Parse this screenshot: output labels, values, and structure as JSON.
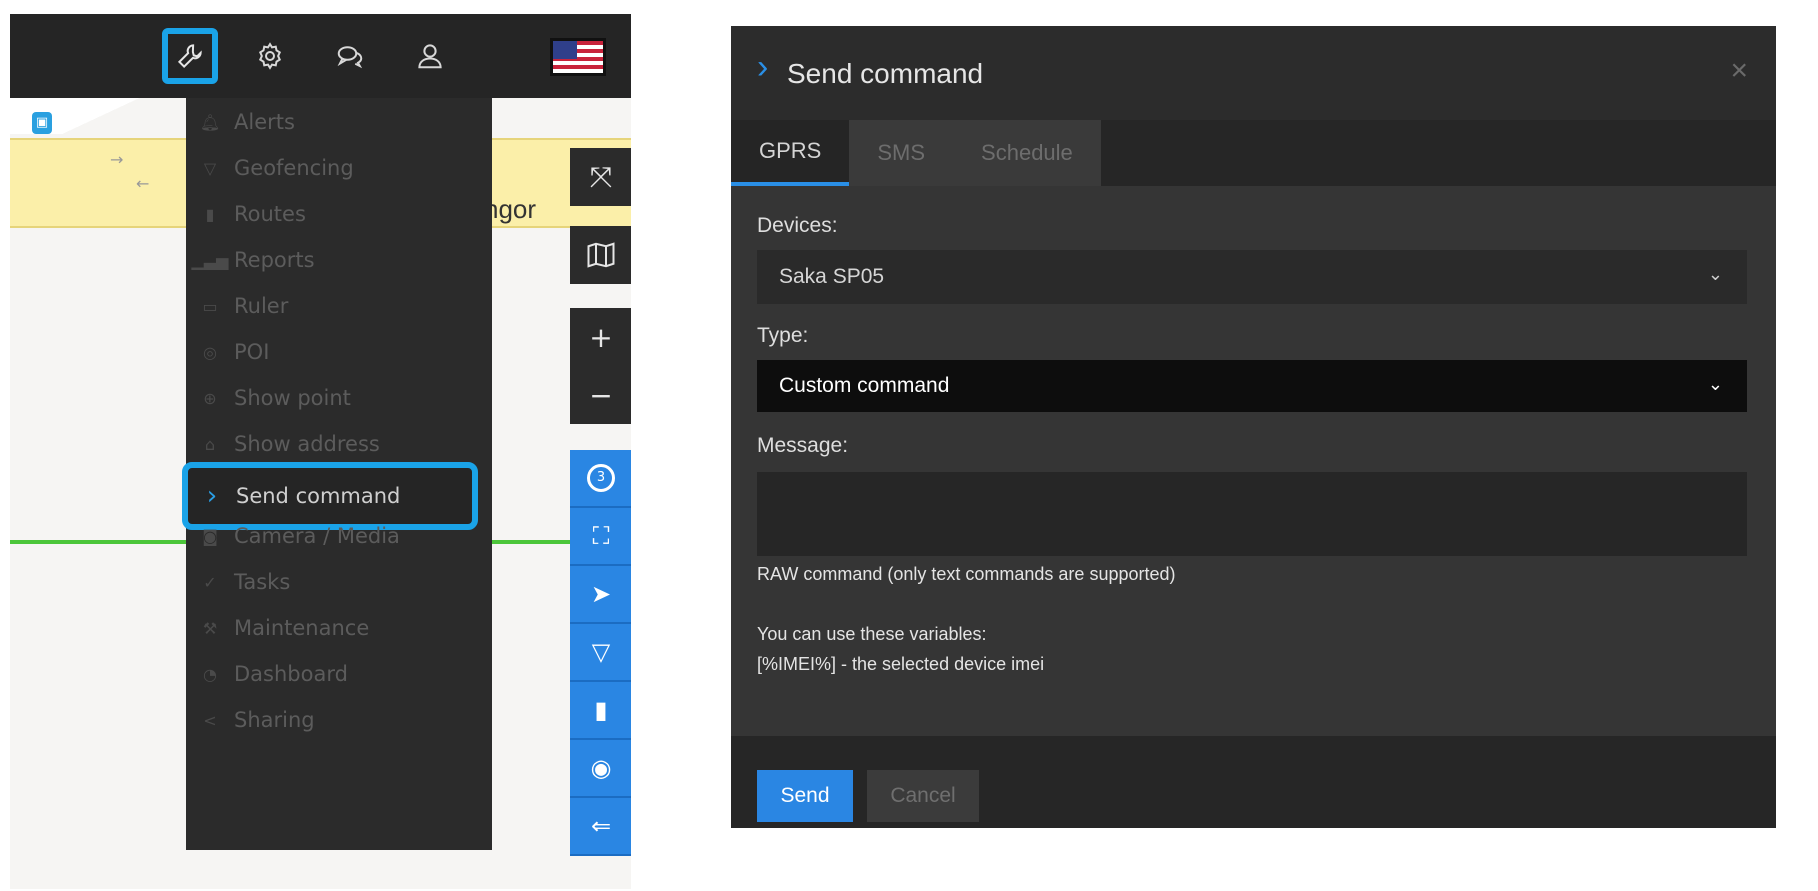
{
  "colors": {
    "accent": "#1aa3e8",
    "primary_button": "#2a86e3",
    "panel_dark": "#262626",
    "menu_bg": "#2b2b2b"
  },
  "toolbar": {
    "icons": [
      "wrench-icon",
      "gear-icon",
      "chat-icon",
      "user-icon",
      "us-flag-icon"
    ],
    "active": "wrench-icon"
  },
  "map": {
    "road_label": "ngor"
  },
  "tools_menu": {
    "items": [
      {
        "label": "Alerts",
        "icon": "bell-icon"
      },
      {
        "label": "Geofencing",
        "icon": "geofence-icon"
      },
      {
        "label": "Routes",
        "icon": "route-icon"
      },
      {
        "label": "Reports",
        "icon": "bar-chart-icon"
      },
      {
        "label": "Ruler",
        "icon": "ruler-icon"
      },
      {
        "label": "POI",
        "icon": "poi-pin-icon"
      },
      {
        "label": "Show point",
        "icon": "crosshair-icon"
      },
      {
        "label": "Show address",
        "icon": "home-icon"
      },
      {
        "label": "Send command",
        "icon": "chevron-right-icon"
      },
      {
        "label": "Camera / Media",
        "icon": "camera-icon"
      },
      {
        "label": "Tasks",
        "icon": "check-icon"
      },
      {
        "label": "Maintenance",
        "icon": "wrench-small-icon"
      },
      {
        "label": "Dashboard",
        "icon": "dashboard-icon"
      },
      {
        "label": "Sharing",
        "icon": "share-icon"
      }
    ],
    "selected": "Send command"
  },
  "map_controls": {
    "dark": [
      "fullscreen-icon",
      "map-layers-icon",
      "zoom-in-icon",
      "zoom-out-icon"
    ],
    "blue": [
      "clusters-icon",
      "fit-bounds-icon",
      "navigate-icon",
      "geofence-toggle-icon",
      "road-icon",
      "pin-icon",
      "history-icon"
    ],
    "clusters_count": "3"
  },
  "dialog": {
    "title": "Send command",
    "tabs": [
      "GPRS",
      "SMS",
      "Schedule"
    ],
    "active_tab": "GPRS",
    "devices_label": "Devices:",
    "devices_value": "Saka SP05",
    "type_label": "Type:",
    "type_value": "Custom command",
    "message_label": "Message:",
    "message_value": "",
    "raw_note": "RAW command (only text commands are supported)",
    "variables_note": "You can use these variables:",
    "variables_line": "[%IMEI%] - the selected device imei",
    "send_label": "Send",
    "cancel_label": "Cancel",
    "close_glyph": "×"
  }
}
